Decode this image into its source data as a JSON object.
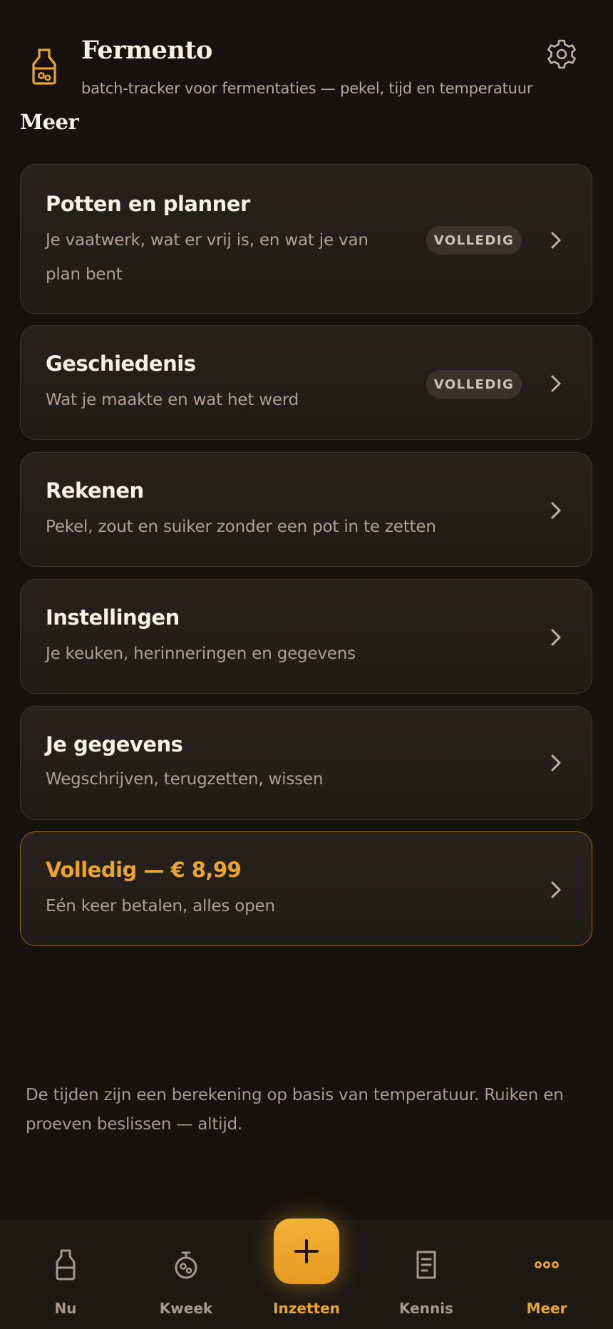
{
  "header": {
    "app_name": "Fermento",
    "subtitle": "batch-tracker voor fermentaties — pekel, tijd en temperatuur",
    "logo_icon": "jar-icon",
    "settings_icon": "gear-icon"
  },
  "section": {
    "title": "Meer"
  },
  "menu": [
    {
      "title": "Potten en planner",
      "desc_line1": "Je vaatwerk, wat er vrij is, en wat je van",
      "desc_line2": "plan bent",
      "badge": "VOLLEDIG"
    },
    {
      "title": "Geschiedenis",
      "desc_line1": "Wat je maakte en wat het werd",
      "badge": "VOLLEDIG"
    },
    {
      "title": "Rekenen",
      "desc_line1": "Pekel, zout en suiker zonder een pot in te zetten"
    },
    {
      "title": "Instellingen",
      "desc_line1": "Je keuken, herinneringen en gegevens"
    },
    {
      "title": "Je gegevens",
      "desc_line1": "Wegschrijven, terugzetten, wissen"
    },
    {
      "title": "Volledig — € 8,99",
      "desc_line1": "Eén keer betalen, alles open"
    }
  ],
  "disclaimer": "De tijden zijn een berekening op basis van temperatuur. Ruiken en proeven beslissen — altijd.",
  "tabs": [
    {
      "label": "Nu",
      "icon": "bottle-icon"
    },
    {
      "label": "Kweek",
      "icon": "culture-jar-icon"
    },
    {
      "label": "Inzetten",
      "icon": "plus-icon"
    },
    {
      "label": "Kennis",
      "icon": "book-icon"
    },
    {
      "label": "Meer",
      "icon": "more-dots-icon"
    }
  ],
  "colors": {
    "background": "#16120f",
    "accent": "#eba52c",
    "card": "#24201b",
    "text_primary": "#f6efe3",
    "text_secondary": "#aba293"
  }
}
